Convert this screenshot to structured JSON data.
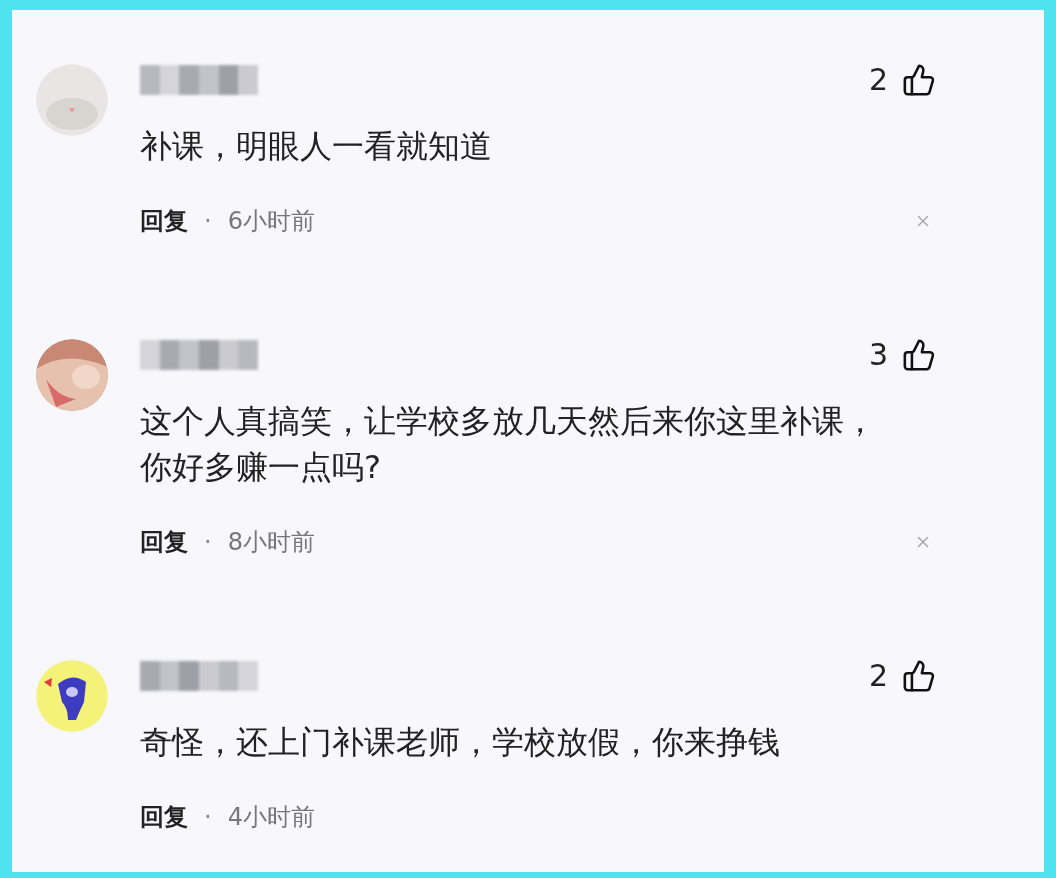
{
  "comments": [
    {
      "likes": "2",
      "text": "补课，明眼人一看就知道",
      "reply": "回复",
      "separator": "·",
      "time": "6小时前",
      "dismissible": true
    },
    {
      "likes": "3",
      "text": "这个人真搞笑，让学校多放几天然后来你这里补课，你好多赚一点吗?",
      "reply": "回复",
      "separator": "·",
      "time": "8小时前",
      "dismissible": true
    },
    {
      "likes": "2",
      "text": "奇怪，还上门补课老师，学校放假，你来挣钱",
      "reply": "回复",
      "separator": "·",
      "time": "4小时前",
      "dismissible": false
    }
  ]
}
